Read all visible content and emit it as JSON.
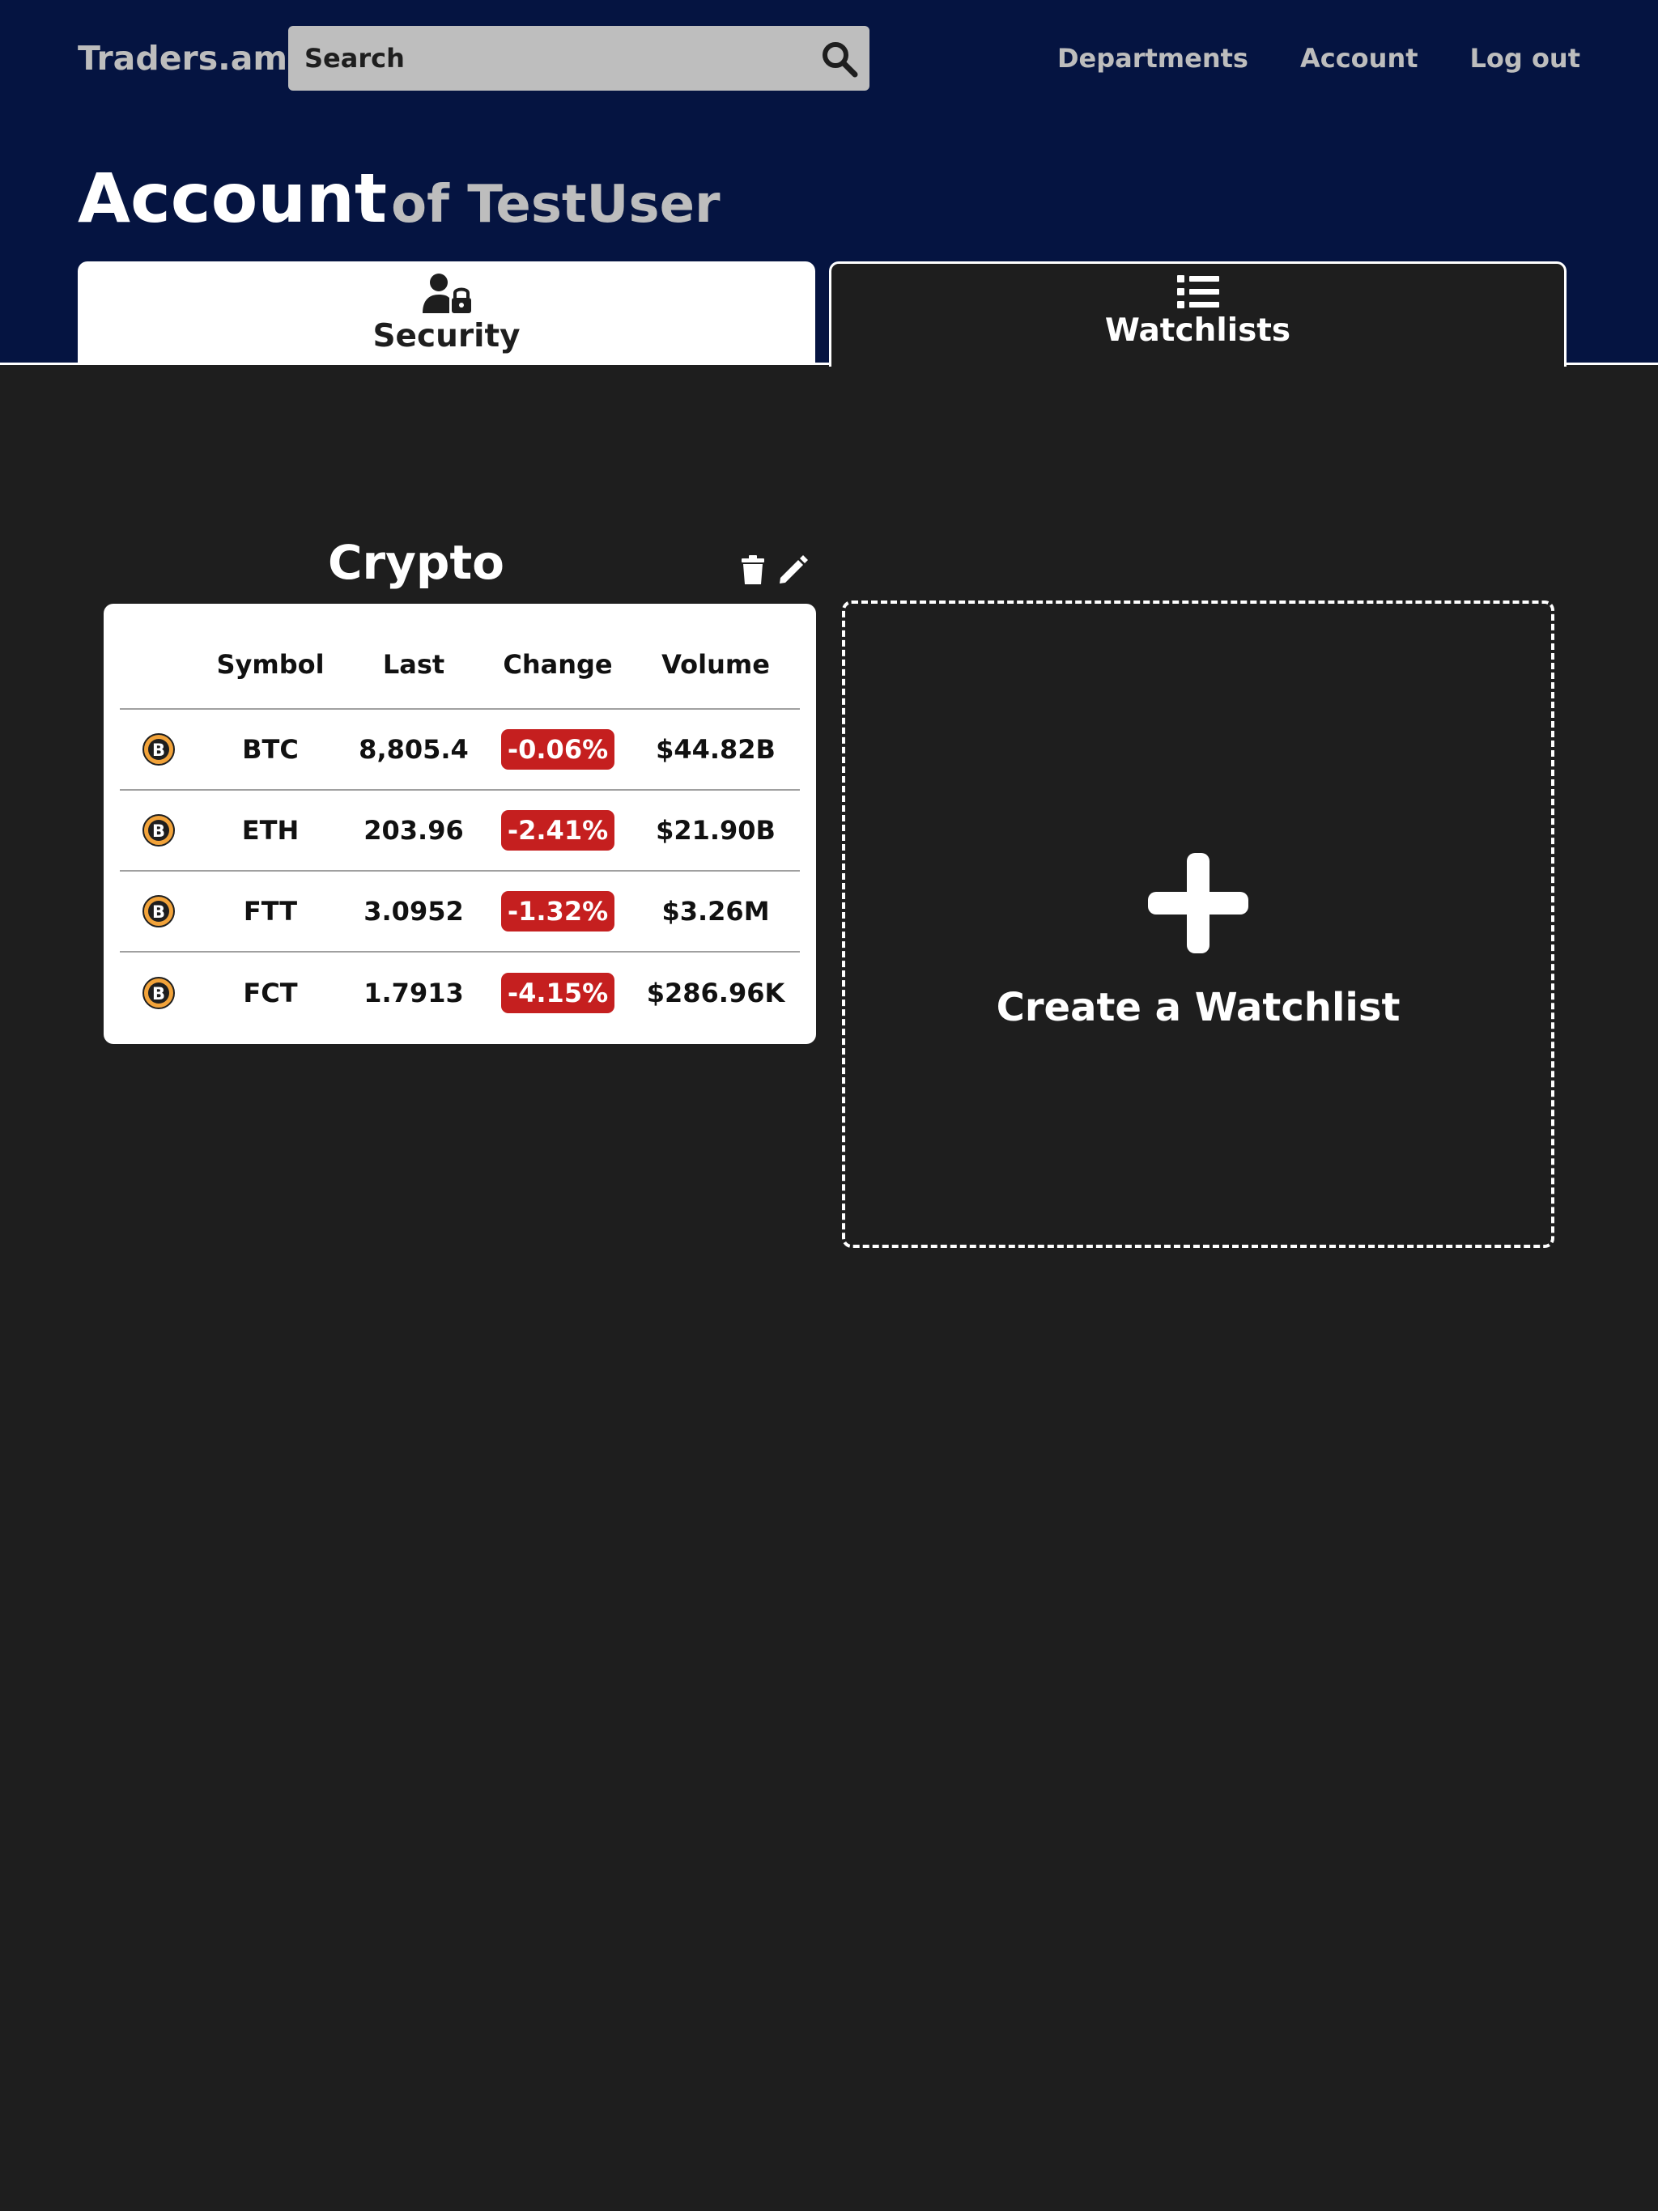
{
  "header": {
    "logo": "Traders.am",
    "search_placeholder": "Search",
    "nav": [
      "Departments",
      "Account",
      "Log out"
    ]
  },
  "page": {
    "title": "Account",
    "subtitle": "of TestUser"
  },
  "tabs": [
    {
      "label": "Security",
      "icon": "user-lock-icon",
      "active": false
    },
    {
      "label": "Watchlists",
      "icon": "list-icon",
      "active": true
    }
  ],
  "watchlist": {
    "name": "Crypto",
    "columns": [
      "",
      "Symbol",
      "Last",
      "Change",
      "Volume"
    ],
    "rows": [
      {
        "symbol": "BTC",
        "last": "8,805.4",
        "change": "-0.06%",
        "volume": "$44.82B"
      },
      {
        "symbol": "ETH",
        "last": "203.96",
        "change": "-2.41%",
        "volume": "$21.90B"
      },
      {
        "symbol": "FTT",
        "last": "3.0952",
        "change": "-1.32%",
        "volume": "$3.26M"
      },
      {
        "symbol": "FCT",
        "last": "1.7913",
        "change": "-4.15%",
        "volume": "$286.96K"
      }
    ]
  },
  "create_watchlist": {
    "label": "Create a Watchlist"
  },
  "colors": {
    "header_bg": "#051441",
    "page_bg": "#1e1e1e",
    "negative_badge": "#c51f1f",
    "coin_gold": "#f2a33a"
  }
}
